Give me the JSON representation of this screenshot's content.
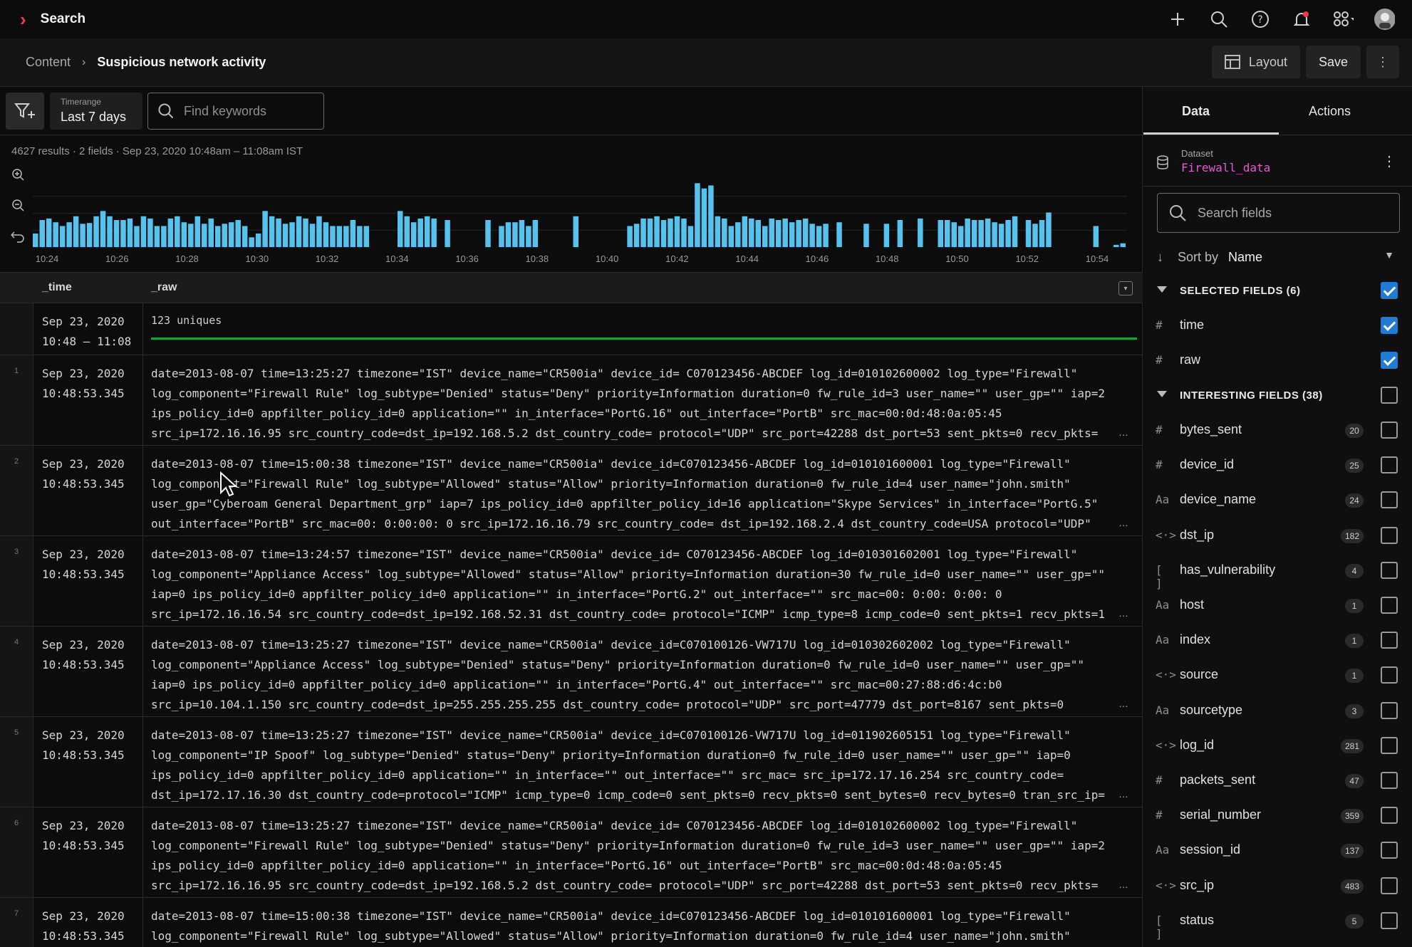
{
  "app": {
    "title": "Search"
  },
  "breadcrumb": {
    "root": "Content",
    "current": "Suspicious network activity"
  },
  "toolbar": {
    "layout_label": "Layout",
    "save_label": "Save"
  },
  "filters": {
    "timerange_label": "Timerange",
    "timerange_value": "Last 7 days",
    "search_placeholder": "Find keywords"
  },
  "summary": "4627 results · 2 fields · Sep 23, 2020 10:48am – 11:08am IST",
  "chart_data": {
    "type": "bar",
    "color": "#55c3ee",
    "x_ticks": [
      "10:24",
      "10:26",
      "10:28",
      "10:30",
      "10:32",
      "10:34",
      "10:36",
      "10:38",
      "10:40",
      "10:42",
      "10:44",
      "10:46",
      "10:48",
      "10:50",
      "10:52",
      "10:54"
    ],
    "values": [
      18,
      36,
      38,
      33,
      28,
      33,
      41,
      31,
      32,
      41,
      48,
      41,
      36,
      36,
      38,
      28,
      41,
      38,
      28,
      28,
      38,
      41,
      33,
      31,
      41,
      31,
      38,
      28,
      31,
      33,
      36,
      28,
      13,
      18,
      48,
      41,
      38,
      31,
      33,
      41,
      38,
      31,
      41,
      33,
      28,
      28,
      28,
      36,
      28,
      28,
      0,
      0,
      0,
      0,
      48,
      41,
      33,
      38,
      41,
      38,
      0,
      36,
      0,
      0,
      0,
      0,
      0,
      36,
      0,
      28,
      33,
      33,
      36,
      28,
      36,
      0,
      0,
      0,
      0,
      0,
      41,
      0,
      0,
      0,
      0,
      0,
      0,
      0,
      28,
      31,
      38,
      38,
      41,
      36,
      38,
      41,
      38,
      28,
      85,
      78,
      82,
      41,
      38,
      28,
      33,
      41,
      38,
      36,
      28,
      38,
      36,
      38,
      33,
      36,
      38,
      31,
      28,
      31,
      0,
      33,
      0,
      0,
      0,
      31,
      0,
      0,
      31,
      0,
      36,
      0,
      0,
      38,
      0,
      0,
      36,
      36,
      33,
      28,
      38,
      36,
      36,
      38,
      33,
      31,
      36,
      41,
      0,
      36,
      31,
      36,
      46,
      0,
      0,
      0,
      0,
      0,
      0,
      28,
      0,
      0,
      3,
      5
    ],
    "ylim": [
      0,
      90
    ]
  },
  "table": {
    "columns": [
      "_time",
      "_raw"
    ],
    "uniques": {
      "time_line1": "Sep 23, 2020",
      "time_line2": "10:48 – 11:08",
      "text": "123 uniques"
    },
    "rows": [
      {
        "num": "1",
        "date": "Sep 23, 2020",
        "time": "10:48:53.345",
        "raw": "date=2013-08-07 time=13:25:27 timezone=\"IST\" device_name=\"CR500ia\" device_id= C070123456-ABCDEF log_id=010102600002 log_type=\"Firewall\"\nlog_component=\"Firewall Rule\" log_subtype=\"Denied\" status=\"Deny\" priority=Information duration=0 fw_rule_id=3 user_name=\"\" user_gp=\"\" iap=2\nips_policy_id=0 appfilter_policy_id=0 application=\"\" in_interface=\"PortG.16\" out_interface=\"PortB\" src_mac=00:0d:48:0a:05:45\nsrc_ip=172.16.16.95 src_country_code=dst_ip=192.168.5.2 dst_country_code= protocol=\"UDP\" src_port=42288 dst_port=53 sent_pkts=0 recv_pkts="
      },
      {
        "num": "2",
        "date": "Sep 23, 2020",
        "time": "10:48:53.345",
        "raw": "date=2013-08-07 time=15:00:38 timezone=\"IST\" device_name=\"CR500ia\" device_id=C070123456-ABCDEF log_id=010101600001 log_type=\"Firewall\"\nlog_component=\"Firewall Rule\" log_subtype=\"Allowed\" status=\"Allow\" priority=Information duration=0 fw_rule_id=4 user_name=\"john.smith\"\nuser_gp=\"Cyberoam General Department_grp\" iap=7 ips_policy_id=0 appfilter_policy_id=16 application=\"Skype Services\" in_interface=\"PortG.5\"\nout_interface=\"PortB\" src_mac=00: 0:00:00: 0 src_ip=172.16.16.79 src_country_code= dst_ip=192.168.2.4 dst_country_code=USA protocol=\"UDP\""
      },
      {
        "num": "3",
        "date": "Sep 23, 2020",
        "time": "10:48:53.345",
        "raw": "date=2013-08-07 time=13:24:57 timezone=\"IST\" device_name=\"CR500ia\" device_id= C070123456-ABCDEF log_id=010301602001 log_type=\"Firewall\"\nlog_component=\"Appliance Access\" log_subtype=\"Allowed\" status=\"Allow\" priority=Information duration=30 fw_rule_id=0 user_name=\"\" user_gp=\"\"\niap=0 ips_policy_id=0 appfilter_policy_id=0 application=\"\" in_interface=\"PortG.2\" out_interface=\"\" src_mac=00: 0:00: 0:00: 0\nsrc_ip=172.16.16.54 src_country_code=dst_ip=192.168.52.31 dst_country_code= protocol=\"ICMP\" icmp_type=8 icmp_code=0 sent_pkts=1 recv_pkts=1"
      },
      {
        "num": "4",
        "date": "Sep 23, 2020",
        "time": "10:48:53.345",
        "raw": "date=2013-08-07 time=13:25:27 timezone=\"IST\" device_name=\"CR500ia\" device_id=C070100126-VW717U log_id=010302602002 log_type=\"Firewall\"\nlog_component=\"Appliance Access\" log_subtype=\"Denied\" status=\"Deny\" priority=Information duration=0 fw_rule_id=0 user_name=\"\" user_gp=\"\"\niap=0 ips_policy_id=0 appfilter_policy_id=0 application=\"\" in_interface=\"PortG.4\" out_interface=\"\" src_mac=00:27:88:d6:4c:b0\nsrc_ip=10.104.1.150 src_country_code=dst_ip=255.255.255.255 dst_country_code= protocol=\"UDP\" src_port=47779 dst_port=8167 sent_pkts=0"
      },
      {
        "num": "5",
        "date": "Sep 23, 2020",
        "time": "10:48:53.345",
        "raw": "date=2013-08-07 time=13:25:27 timezone=\"IST\" device_name=\"CR500ia\" device_id=C070100126-VW717U log_id=011902605151 log_type=\"Firewall\"\nlog_component=\"IP Spoof\" log_subtype=\"Denied\" status=\"Deny\" priority=Information duration=0 fw_rule_id=0 user_name=\"\" user_gp=\"\" iap=0\nips_policy_id=0 appfilter_policy_id=0 application=\"\" in_interface=\"\" out_interface=\"\" src_mac= src_ip=172.17.16.254 src_country_code=\ndst_ip=172.17.16.30 dst_country_code=protocol=\"ICMP\" icmp_type=0 icmp_code=0 sent_pkts=0 recv_pkts=0 sent_bytes=0 recv_bytes=0 tran_src_ip="
      },
      {
        "num": "6",
        "date": "Sep 23, 2020",
        "time": "10:48:53.345",
        "raw": "date=2013-08-07 time=13:25:27 timezone=\"IST\" device_name=\"CR500ia\" device_id= C070123456-ABCDEF log_id=010102600002 log_type=\"Firewall\"\nlog_component=\"Firewall Rule\" log_subtype=\"Denied\" status=\"Deny\" priority=Information duration=0 fw_rule_id=3 user_name=\"\" user_gp=\"\" iap=2\nips_policy_id=0 appfilter_policy_id=0 application=\"\" in_interface=\"PortG.16\" out_interface=\"PortB\" src_mac=00:0d:48:0a:05:45\nsrc_ip=172.16.16.95 src_country_code=dst_ip=192.168.5.2 dst_country_code= protocol=\"UDP\" src_port=42288 dst_port=53 sent_pkts=0 recv_pkts="
      },
      {
        "num": "7",
        "date": "Sep 23, 2020",
        "time": "10:48:53.345",
        "raw": "date=2013-08-07 time=15:00:38 timezone=\"IST\" device_name=\"CR500ia\" device_id=C070123456-ABCDEF log_id=010101600001 log_type=\"Firewall\"\nlog_component=\"Firewall Rule\" log_subtype=\"Allowed\" status=\"Allow\" priority=Information duration=0 fw_rule_id=4 user_name=\"john.smith\""
      }
    ]
  },
  "sidebar": {
    "tabs": [
      "Data",
      "Actions"
    ],
    "dataset_label": "Dataset",
    "dataset_value": "Firewall_data",
    "search_placeholder": "Search fields",
    "sort_label": "Sort by",
    "sort_value": "Name",
    "selected_group": "SELECTED FIELDS (6)",
    "interesting_group": "INTERESTING FIELDS (38)",
    "selected_fields": [
      {
        "type": "#",
        "name": "time"
      },
      {
        "type": "#",
        "name": "raw"
      }
    ],
    "interesting_fields": [
      {
        "type": "#",
        "name": "bytes_sent",
        "count": "20"
      },
      {
        "type": "#",
        "name": "device_id",
        "count": "25"
      },
      {
        "type": "Aa",
        "name": "device_name",
        "count": "24"
      },
      {
        "type": "<·>",
        "name": "dst_ip",
        "count": "182"
      },
      {
        "type": "[ ]",
        "name": "has_vulnerability",
        "count": "4"
      },
      {
        "type": "Aa",
        "name": "host",
        "count": "1"
      },
      {
        "type": "Aa",
        "name": "index",
        "count": "1"
      },
      {
        "type": "<·>",
        "name": "source",
        "count": "1"
      },
      {
        "type": "Aa",
        "name": "sourcetype",
        "count": "3"
      },
      {
        "type": "<·>",
        "name": "log_id",
        "count": "281"
      },
      {
        "type": "#",
        "name": "packets_sent",
        "count": "47"
      },
      {
        "type": "#",
        "name": "serial_number",
        "count": "359"
      },
      {
        "type": "Aa",
        "name": "session_id",
        "count": "137"
      },
      {
        "type": "<·>",
        "name": "src_ip",
        "count": "483"
      },
      {
        "type": "[ ]",
        "name": "status",
        "count": "5"
      }
    ]
  }
}
